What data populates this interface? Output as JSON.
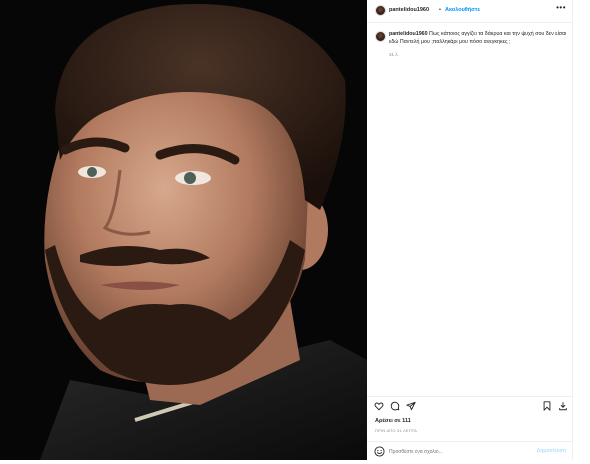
{
  "post": {
    "photo_alt": "photo",
    "header": {
      "username": "pantelidou1960",
      "separator": "•",
      "follow_label": "Ακολουθήστε",
      "more_icon": "more-icon"
    },
    "caption": {
      "username": "pantelidou1960",
      "text": "Πως κάποιος αγγίζει τα δάκρυα και την ψυχή σου δεν είσαι εδώ Παντελή μου ;παλληκάρι μου πόσο ανεγκηκες ;",
      "time": "31 λ."
    },
    "actions": {
      "like_icon": "heart-icon",
      "comment_icon": "comment-icon",
      "share_icon": "send-icon",
      "save_icon": "bookmark-icon",
      "download_icon": "download-icon"
    },
    "likes_text": "Αρέσει σε 111",
    "date_text": "ΠΡΙΝ ΑΠΟ 31 ΛΕΠΤΑ",
    "comment": {
      "placeholder": "Προσθέστε ένα σχόλιο...",
      "publish_label": "Δημοσίευση"
    },
    "colors": {
      "accent": "#0095f6",
      "accent_disabled": "#b2dffc",
      "text": "#262626",
      "muted": "#8e8e8e",
      "border": "#efefef"
    }
  }
}
